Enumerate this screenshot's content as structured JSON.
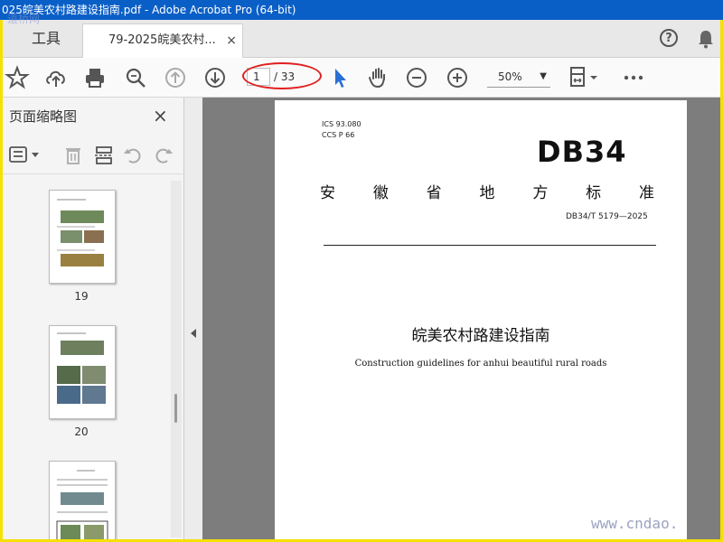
{
  "window": {
    "title": "025皖美农村路建设指南.pdf - Adobe Acrobat Pro (64-bit)"
  },
  "tabs": {
    "tools_label": "工具",
    "document_label": "79-2025皖美农村...",
    "close_glyph": "×"
  },
  "header_icons": {
    "help_glyph": "?",
    "help": "help-icon",
    "notifications": "bell-icon"
  },
  "toolbar": {
    "page_current": "1",
    "page_total": "/ 33",
    "zoom_value": "50%",
    "icons": [
      "bookmark-star-icon",
      "upload-cloud-icon",
      "print-icon",
      "zoom-search-icon",
      "prev-page-icon",
      "next-page-icon",
      "select-cursor-icon",
      "hand-icon",
      "zoom-out-icon",
      "zoom-in-icon",
      "page-fit-icon",
      "more-icon"
    ]
  },
  "sidebar": {
    "title": "页面缩略图",
    "close_glyph": "×",
    "thumbnails": [
      {
        "label": "19"
      },
      {
        "label": "20"
      },
      {
        "label": ""
      }
    ]
  },
  "document": {
    "ics": "ICS  93.080",
    "ccs": "CCS  P  66",
    "badge": "DB34",
    "province_chars": [
      "安",
      "徽",
      "省",
      "地",
      "方",
      "标",
      "准"
    ],
    "standard_number": "DB34/T  5179—2025",
    "title_cn": "皖美农村路建设指南",
    "title_en": "Construction guidelines for anhui beautiful rural roads"
  },
  "watermarks": {
    "top_left": "道桥网",
    "bottom_right": "www.cndao."
  },
  "colors": {
    "titlebar": "#0a5fc7",
    "frame": "#f5e100",
    "highlight_oval": "#e02020",
    "select_tool": "#2a6fd6"
  }
}
